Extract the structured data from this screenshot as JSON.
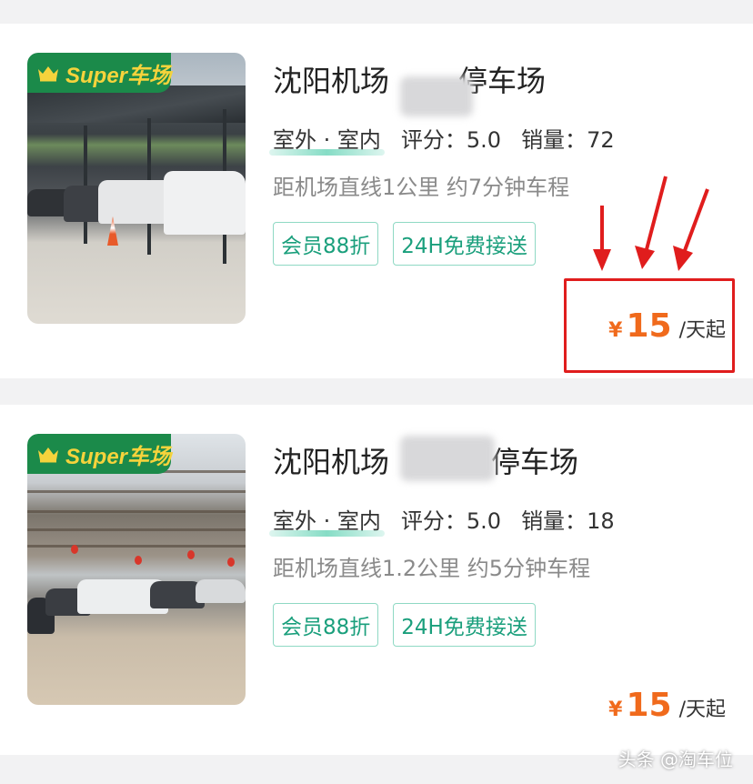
{
  "listings": [
    {
      "badge": "Super车场",
      "title": "沈阳机场",
      "title_suffix": "停车场",
      "type_label": "室外 · 室内",
      "rating_label": "评分：",
      "rating": "5.0",
      "sales_label": "销量：",
      "sales": "72",
      "distance": "距机场直线1公里 约7分钟车程",
      "tags": [
        "会员88折",
        "24H免费接送"
      ],
      "price_symbol": "¥",
      "price": "15",
      "price_unit": "/天起"
    },
    {
      "badge": "Super车场",
      "title": "沈阳机场",
      "title_suffix": "停车场",
      "type_label": "室外 · 室内",
      "rating_label": "评分：",
      "rating": "5.0",
      "sales_label": "销量：",
      "sales": "18",
      "distance": "距机场直线1.2公里 约5分钟车程",
      "tags": [
        "会员88折",
        "24H免费接送"
      ],
      "price_symbol": "¥",
      "price": "15",
      "price_unit": "/天起"
    }
  ],
  "watermark": "头条 @淘车位",
  "colors": {
    "badge_bg": "#1b8a4a",
    "badge_text": "#f5d33c",
    "price": "#f06a1c",
    "tag_text": "#1a9f7c",
    "tag_border": "#8fd9c4",
    "highlight": "#e01d1d"
  },
  "icons": [
    "crown-icon",
    "arrow-icon"
  ]
}
